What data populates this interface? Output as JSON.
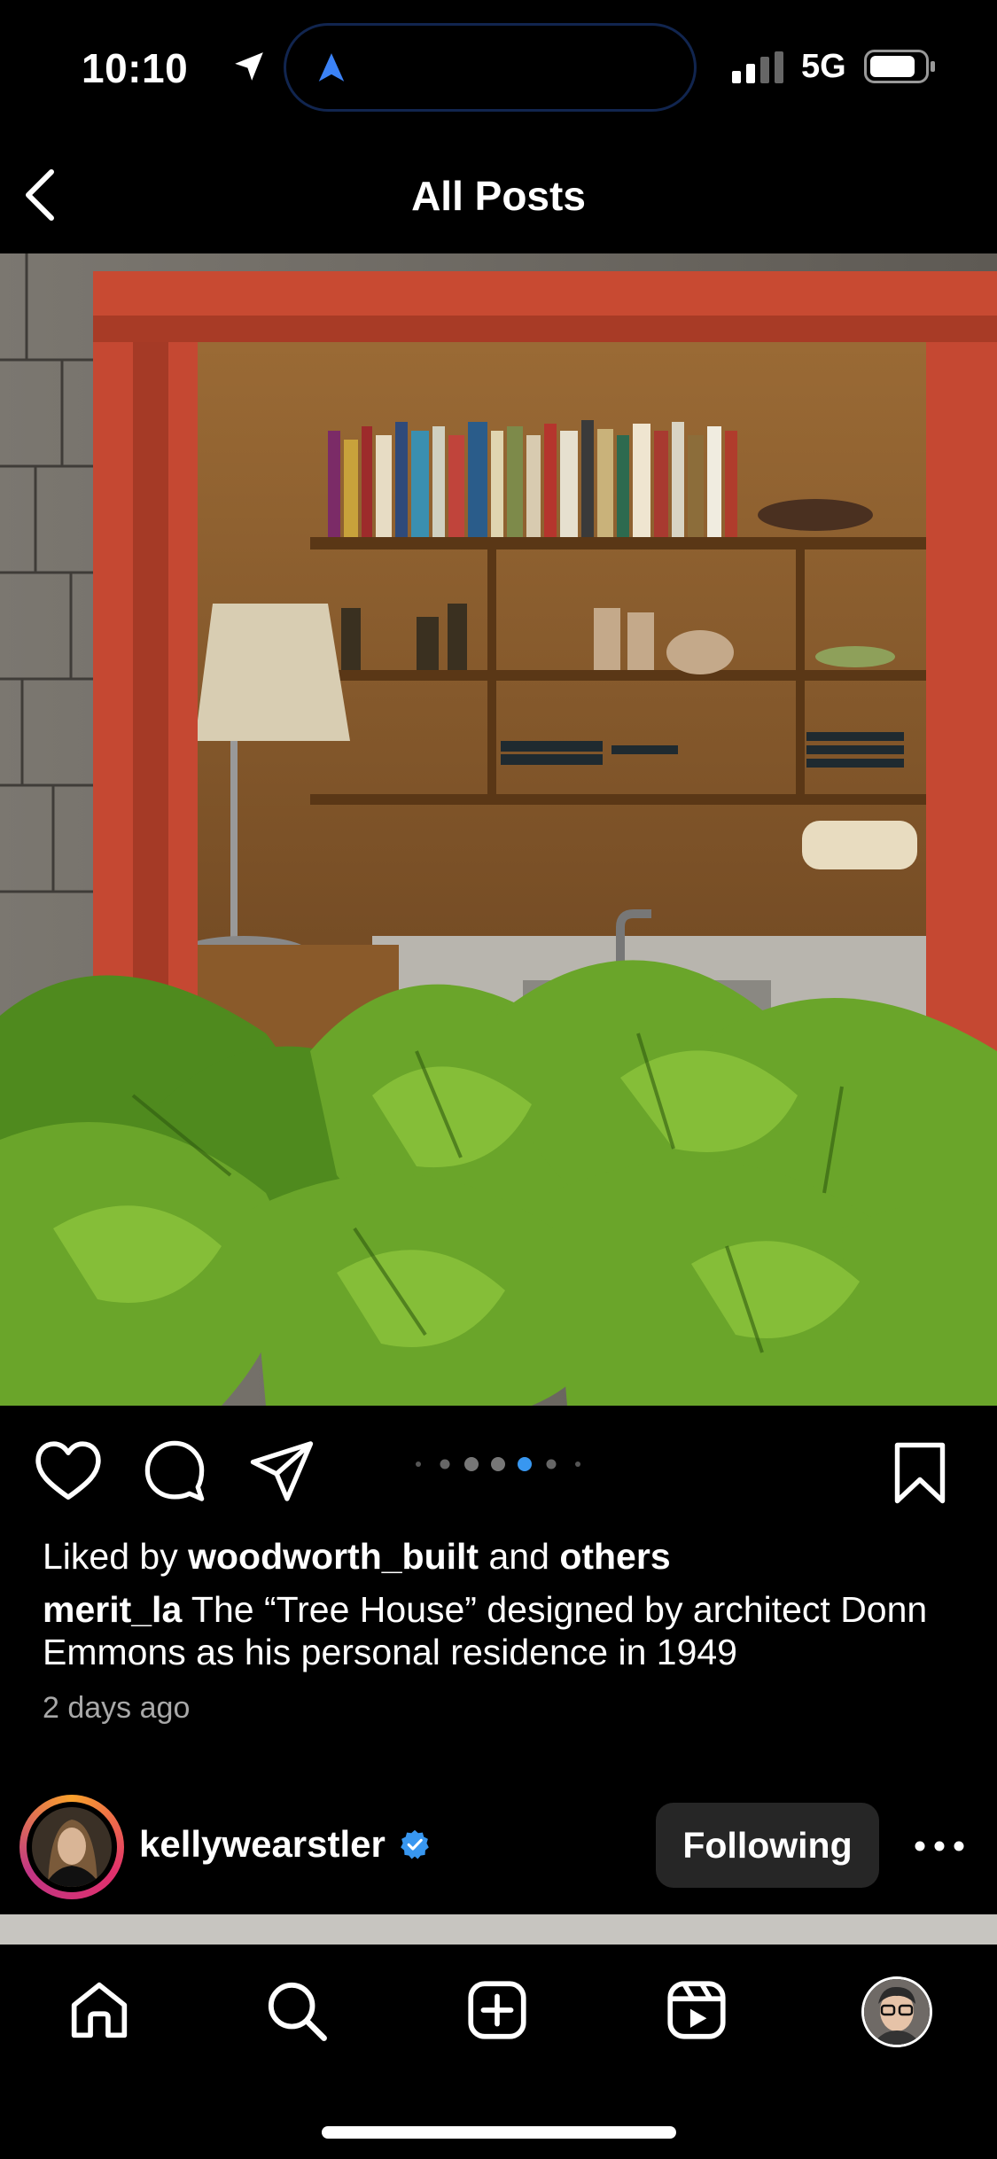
{
  "status_bar": {
    "time": "10:10",
    "network": "5G",
    "icons": [
      "location-arrow-icon",
      "signal-icon",
      "battery-icon"
    ]
  },
  "header": {
    "title": "All Posts",
    "back_icon": "chevron-left-icon"
  },
  "post": {
    "image_description_icons": [
      "photo"
    ],
    "carousel": {
      "count": 7,
      "active_index": 4
    },
    "actions": [
      "heart-icon",
      "comment-icon",
      "share-icon",
      "bookmark-icon"
    ],
    "liked_prefix": "Liked by",
    "liked_user": "woodworth_built",
    "liked_middle": "and",
    "liked_others": "others",
    "caption_user": "merit_la",
    "caption_text": "The “Tree House” designed by architect Donn Emmons as his personal residence in 1949",
    "timestamp": "2 days ago"
  },
  "next_post": {
    "username": "kellywearstler",
    "verified": true,
    "follow_button": "Following",
    "more_icon": "more-horizontal-icon"
  },
  "tab_bar": {
    "items": [
      "home-icon",
      "search-icon",
      "create-icon",
      "reels-icon",
      "profile-avatar"
    ]
  },
  "colors": {
    "background": "#000000",
    "accent_blue": "#3897f0",
    "button_bg": "#262626",
    "muted_text": "#a8a8a8"
  }
}
